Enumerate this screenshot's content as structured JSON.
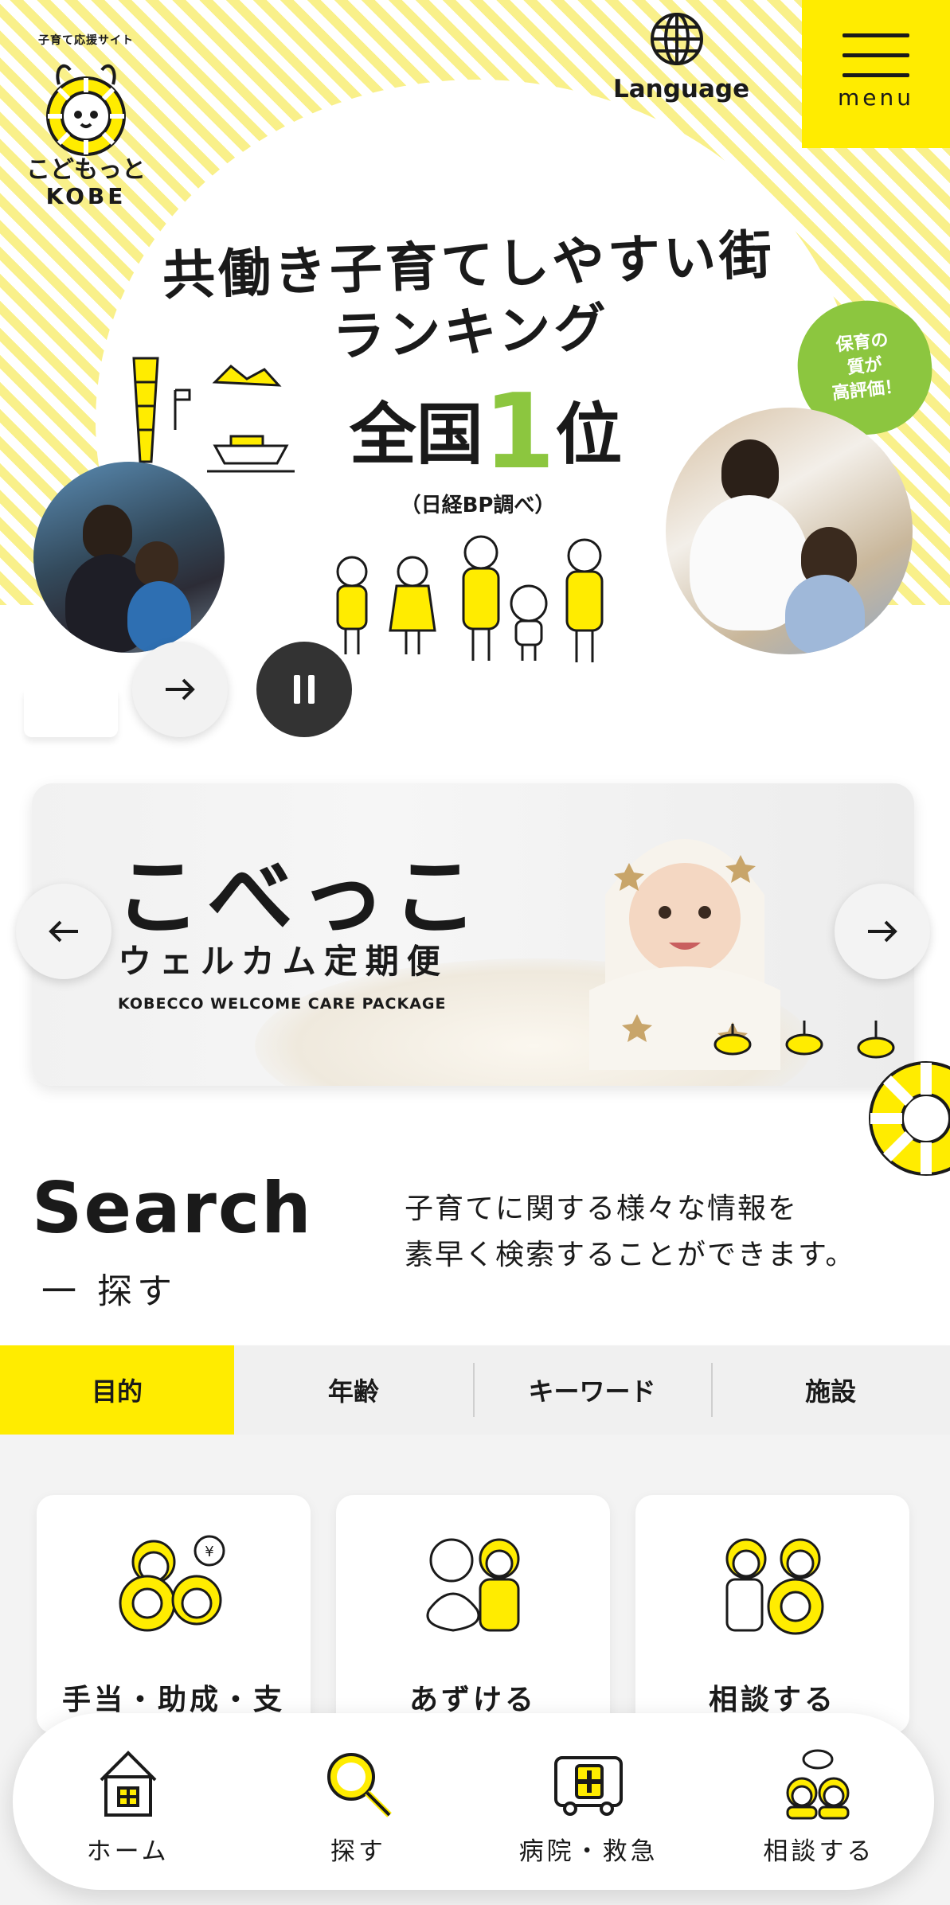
{
  "header": {
    "logo_tagline": "子育て応援サイト",
    "logo_name": "こどもっと",
    "logo_en": "KOBE",
    "language_label": "Language",
    "menu_label": "menu"
  },
  "hero": {
    "title_line1": "共働き子育てしやすい街",
    "title_line2": "ランキング",
    "rank_prefix": "全国",
    "rank_number": "1",
    "rank_suffix": "位",
    "source_note": "（日経BP調べ）",
    "badge_line1": "保育の",
    "badge_line2": "質が",
    "badge_line3": "高評価！"
  },
  "banner": {
    "title": "こべっこ",
    "subtitle": "ウェルカム定期便",
    "english": "KOBECCO WELCOME CARE PACKAGE"
  },
  "search": {
    "title": "Search",
    "subtitle": "一 探す",
    "desc_line1": "子育てに関する様々な情報を",
    "desc_line2": "素早く検索することができます。",
    "tabs": [
      "目的",
      "年齢",
      "キーワード",
      "施設"
    ],
    "active_tab": "目的",
    "cards": [
      "手当・助成・支",
      "あずける",
      "相談する"
    ]
  },
  "bottom_nav": {
    "items": [
      "ホーム",
      "探す",
      "病院・救急",
      "相談する"
    ]
  },
  "colors": {
    "accent_yellow": "#ffec00",
    "accent_green": "#8cc63f",
    "dark": "#1a1a1a"
  }
}
